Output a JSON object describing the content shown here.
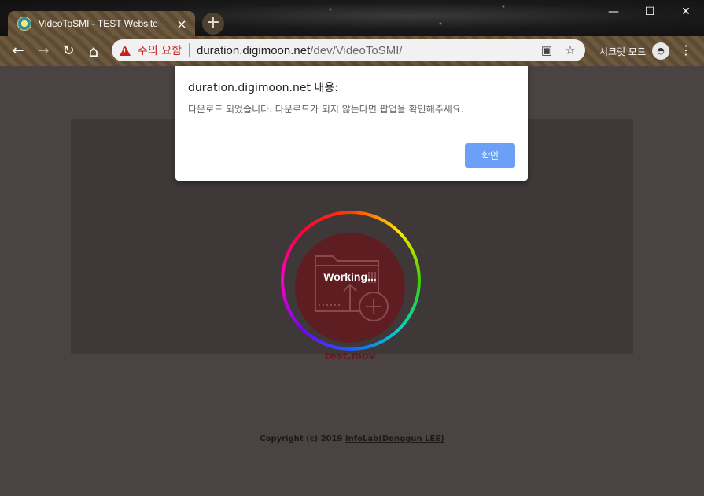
{
  "browser": {
    "tab": {
      "title": "VideoToSMI - TEST Website",
      "close": "×"
    },
    "new_tab": "+",
    "window_controls": {
      "minimize": "—",
      "maximize": "☐",
      "close": "✕"
    },
    "nav": {
      "back": "←",
      "forward": "→",
      "reload": "↻",
      "home": "⌂"
    },
    "omnibox": {
      "warning_text": "주의 요함",
      "url_host": "duration.digimoon.net",
      "url_path": "/dev/VideoToSMI/",
      "popup_blocked_icon": "▣",
      "bookmark_icon": "☆"
    },
    "incognito_label": "시크릿 모드",
    "incognito_icon": "◓",
    "menu_icon": "⋮"
  },
  "dialog": {
    "title": "duration.digimoon.net 내용:",
    "message": "다운로드 되었습니다. 다운로드가 되지 않는다면 팝업을 확인해주세요.",
    "ok_label": "확인"
  },
  "main": {
    "status": "Working...",
    "filename": "test.mov"
  },
  "footer": {
    "prefix": "Copyright (c) 2019 ",
    "link": "InfoLab(Donggun LEE)"
  },
  "colors": {
    "page_bg": "#4a4342",
    "panel_bg": "#3e3938",
    "accent_circle": "#5e1d21",
    "dialog_button": "#6aa0f5",
    "warning": "#c5221f"
  }
}
